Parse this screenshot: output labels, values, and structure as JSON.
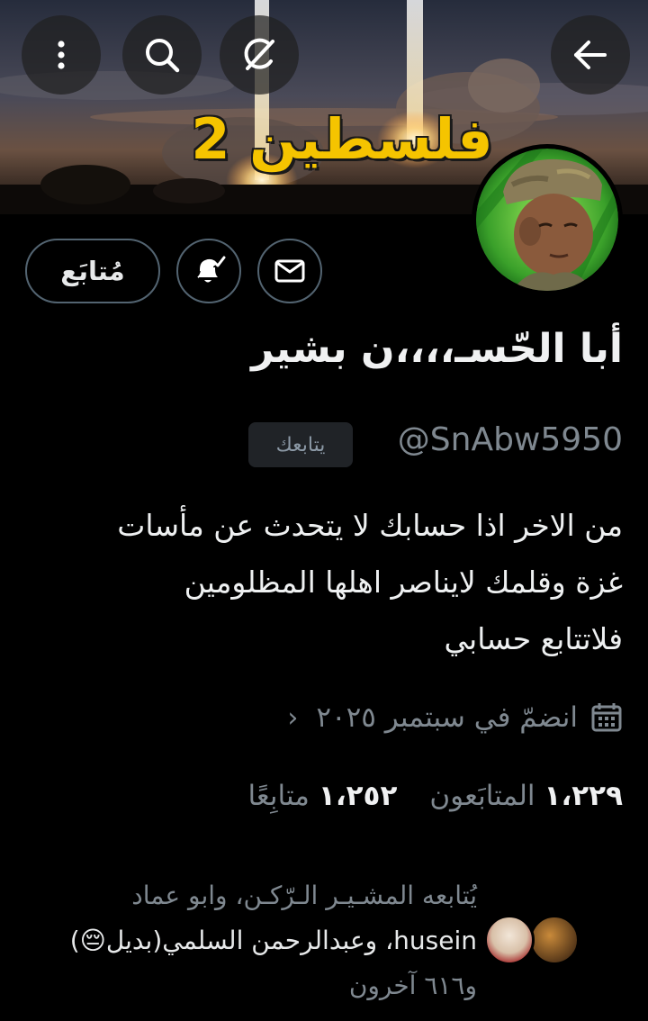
{
  "banner": {
    "title": "فلسطين 2",
    "back_icon": "arrow-left-icon",
    "grok_icon": "grok-icon",
    "search_icon": "search-icon",
    "more_icon": "more-vertical-icon"
  },
  "actions": {
    "follow_label": "مُتابَع",
    "notify_icon": "bell-check-icon",
    "message_icon": "mail-icon"
  },
  "profile": {
    "display_name": "أبا الحّسـ،،،،ن بشير",
    "handle": "@SnAbw5950",
    "follows_you": "يتابعك",
    "bio_lines": [
      "من الاخر اذا حسابك لا يتحدث عن مأسات",
      "غزة وقلمك لايناصر اهلها المظلومين",
      "فلاتتابع حسابي"
    ],
    "joined": "انضمّ في سبتمبر ٢٠٢٥"
  },
  "stats": {
    "followers_count": "١،٢٢٩",
    "followers_label": "المتابَعون",
    "following_count": "١،٢٥٢",
    "following_label": "متابِعًا"
  },
  "known_followers": {
    "line1": "يُتابعه المشـيـر الـرّكـن، وابو عماد",
    "line2_name": "husein",
    "line2_rest": "، وعبدالرحمن السلمي(بديل😔)",
    "line3": "و٦١٦ آخرون"
  },
  "colors": {
    "background": "#000000",
    "text_primary": "#e7e9ea",
    "text_secondary": "#7f8890",
    "border": "#536471",
    "title_yellow": "#f5c400"
  }
}
